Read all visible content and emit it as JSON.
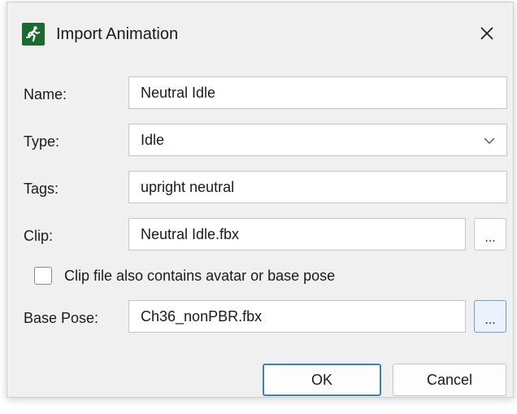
{
  "dialog": {
    "title": "Import Animation",
    "close_icon": "close-icon"
  },
  "form": {
    "name_label": "Name:",
    "name_value": "Neutral Idle",
    "type_label": "Type:",
    "type_value": "Idle",
    "tags_label": "Tags:",
    "tags_value": "upright neutral",
    "clip_label": "Clip:",
    "clip_value": "Neutral Idle.fbx",
    "clip_browse": "...",
    "checkbox_label": "Clip file also contains avatar or base pose",
    "checkbox_checked": false,
    "base_pose_label": "Base Pose:",
    "base_pose_value": "Ch36_nonPBR.fbx",
    "base_pose_browse": "..."
  },
  "buttons": {
    "ok": "OK",
    "cancel": "Cancel"
  },
  "colors": {
    "app_icon_bg": "#1d6b2c",
    "primary_border": "#3b7fd0",
    "focused_browse_border": "#6aa0d8"
  }
}
